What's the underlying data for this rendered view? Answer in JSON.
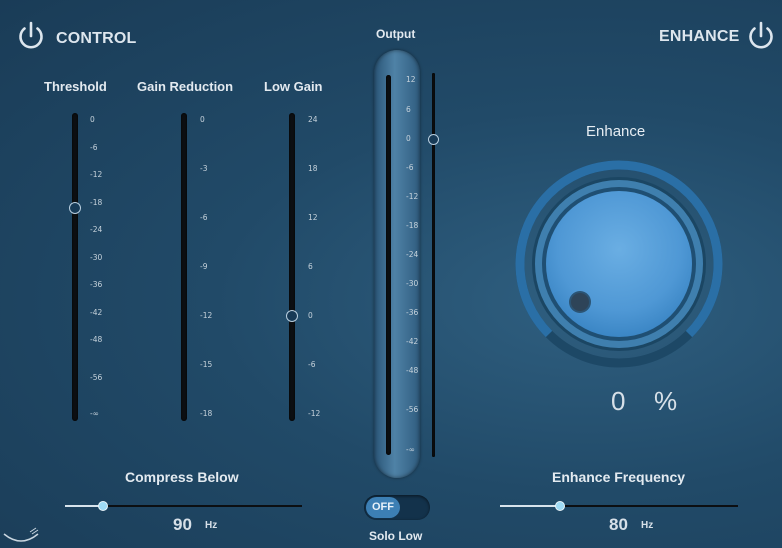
{
  "control": {
    "title": "CONTROL",
    "power_on": true
  },
  "enhance_section": {
    "title": "ENHANCE",
    "power_on": true
  },
  "threshold": {
    "label": "Threshold",
    "ticks": [
      "0",
      "-6",
      "-12",
      "-18",
      "-24",
      "-30",
      "-36",
      "-42",
      "-48",
      "-56",
      "-∞"
    ],
    "value_db": -19
  },
  "gain_reduction": {
    "label": "Gain Reduction",
    "ticks": [
      "0",
      "-3",
      "-6",
      "-9",
      "-12",
      "-15",
      "-18"
    ],
    "level_db": 0
  },
  "low_gain": {
    "label": "Low Gain",
    "ticks": [
      "24",
      "18",
      "12",
      "6",
      "0",
      "-6",
      "-12"
    ],
    "value_db": 0
  },
  "output": {
    "label": "Output",
    "ticks": [
      "12",
      "6",
      "0",
      "-6",
      "-12",
      "-18",
      "-24",
      "-30",
      "-36",
      "-42",
      "-48",
      "-56",
      "-∞"
    ],
    "value_db": 0
  },
  "compress_below": {
    "label": "Compress Below",
    "value": "90",
    "unit": "Hz",
    "position": 0.16
  },
  "solo_low": {
    "label": "Solo Low",
    "state": "OFF"
  },
  "enhance": {
    "label": "Enhance",
    "value": "0",
    "unit": "%"
  },
  "enhance_frequency": {
    "label": "Enhance Frequency",
    "value": "80",
    "unit": "Hz",
    "position": 0.25
  },
  "colors": {
    "accent": "#5aa8e3",
    "slider_thumb": "#9fdbf5",
    "background": "#214a68"
  }
}
